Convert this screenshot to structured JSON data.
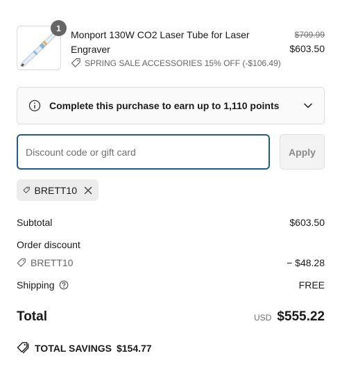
{
  "product": {
    "quantity": "1",
    "name": "Monport 130W CO2 Laser Tube for Laser Engraver",
    "discount_label": "SPRING SALE ACCESSORIES 15% OFF (-$106.49)",
    "compare_price": "$709.99",
    "price": "$603.50",
    "thumbnail_icon": "laser-tube-image"
  },
  "points": {
    "text": "Complete this purchase to earn up to 1,110 points"
  },
  "discount": {
    "placeholder": "Discount code or gift card",
    "value": "",
    "apply_label": "Apply",
    "applied_code": "BRETT10"
  },
  "summary": {
    "subtotal_label": "Subtotal",
    "subtotal_value": "$603.50",
    "order_discount_label": "Order discount",
    "order_discount_code": "BRETT10",
    "order_discount_value": "− $48.28",
    "shipping_label": "Shipping",
    "shipping_value": "FREE",
    "total_label": "Total",
    "currency": "USD",
    "total_value": "$555.22",
    "savings_label": "TOTAL SAVINGS",
    "savings_value": "$154.77"
  },
  "colors": {
    "focus_border": "#1e5c8c",
    "badge": "#666666",
    "chip_bg": "#ececec"
  }
}
